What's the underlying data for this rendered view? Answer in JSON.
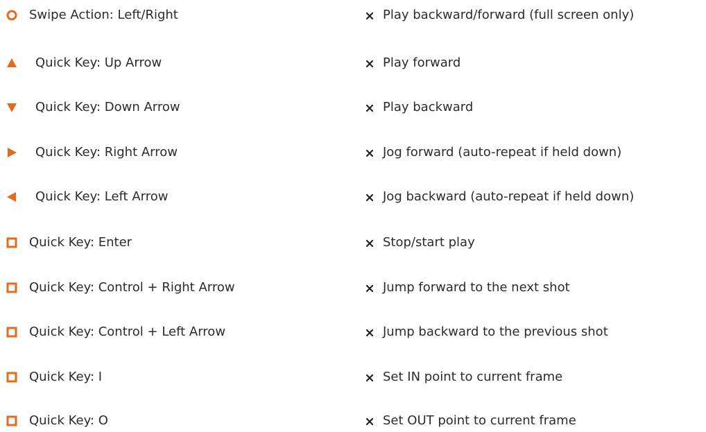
{
  "accent_color": "#e46a1c",
  "bullet_glyph": "✖",
  "shortcuts": [
    {
      "icon": "circle-icon",
      "key": "Swipe Action: Left/Right",
      "action": "Play backward/forward (full screen only)"
    },
    {
      "icon": "triangle-up-icon",
      "key": "Quick Key: Up Arrow",
      "action": "Play forward"
    },
    {
      "icon": "triangle-down-icon",
      "key": "Quick Key: Down Arrow",
      "action": "Play backward"
    },
    {
      "icon": "triangle-right-icon",
      "key": "Quick Key: Right Arrow",
      "action": "Jog forward (auto-repeat if held down)"
    },
    {
      "icon": "triangle-left-icon",
      "key": "Quick Key: Left Arrow",
      "action": "Jog backward (auto-repeat if held down)"
    },
    {
      "icon": "square-icon",
      "key": "Quick Key: Enter",
      "action": "Stop/start play"
    },
    {
      "icon": "square-icon",
      "key": "Quick Key: Control + Right Arrow",
      "action": "Jump forward to the next shot"
    },
    {
      "icon": "square-icon",
      "key": "Quick Key: Control + Left Arrow",
      "action": "Jump backward to the previous shot"
    },
    {
      "icon": "square-icon",
      "key": "Quick Key: I",
      "action": "Set IN point to current frame"
    },
    {
      "icon": "square-icon",
      "key": "Quick Key: O",
      "action": "Set OUT point to current frame"
    }
  ]
}
